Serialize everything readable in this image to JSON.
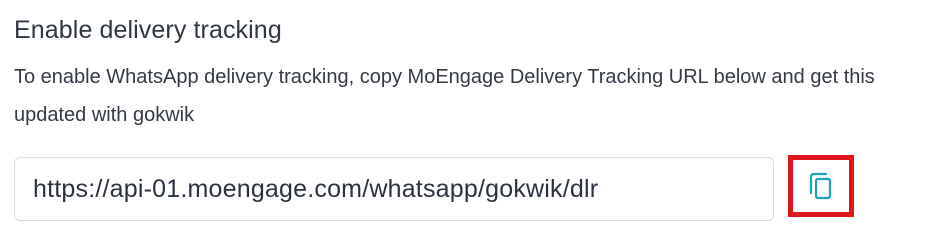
{
  "section": {
    "title": "Enable delivery tracking",
    "description": "To enable WhatsApp delivery tracking, copy MoEngage Delivery Tracking URL below and get this updated with gokwik"
  },
  "tracking_url": {
    "value": "https://api-01.moengage.com/whatsapp/gokwik/dlr"
  },
  "copy_button": {
    "icon": "copy-icon",
    "icon_color": "#1aa3b8",
    "highlight_color": "#e0161d"
  }
}
